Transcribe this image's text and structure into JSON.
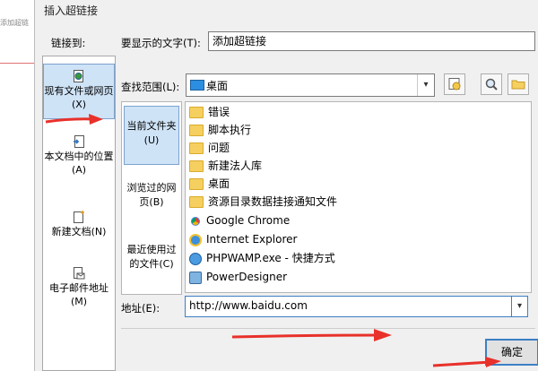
{
  "background": {
    "parent_text": "添加超链"
  },
  "dialog": {
    "title": "插入超链接",
    "link_to_label": "链接到:",
    "link_types": [
      {
        "label": "现有文件或网页(X)",
        "icon": "web-page-icon",
        "selected": true
      },
      {
        "label": "本文档中的位置(A)",
        "icon": "document-place-icon",
        "selected": false
      },
      {
        "label": "新建文档(N)",
        "icon": "new-document-icon",
        "selected": false
      },
      {
        "label": "电子邮件地址(M)",
        "icon": "email-icon",
        "selected": false
      }
    ],
    "display_text": {
      "label": "要显示的文字(T):",
      "value": "添加超链接"
    },
    "look_in": {
      "label": "查找范围(L):",
      "value": "桌面",
      "icon": "monitor-icon"
    },
    "nav_items": [
      {
        "label": "当前文件夹(U)",
        "selected": true
      },
      {
        "label": "浏览过的网页(B)",
        "selected": false
      },
      {
        "label": "最近使用过的文件(C)",
        "selected": false
      }
    ],
    "files": [
      {
        "name": "错误",
        "type": "folder"
      },
      {
        "name": "脚本执行",
        "type": "folder"
      },
      {
        "name": "问题",
        "type": "folder"
      },
      {
        "name": "新建法人库",
        "type": "folder"
      },
      {
        "name": "桌面",
        "type": "folder"
      },
      {
        "name": "资源目录数据挂接通知文件",
        "type": "folder"
      },
      {
        "name": "Google Chrome",
        "type": "app",
        "icon": "chrome-icon"
      },
      {
        "name": "Internet Explorer",
        "type": "app",
        "icon": "ie-icon"
      },
      {
        "name": "PHPWAMP.exe - 快捷方式",
        "type": "app",
        "icon": "phpwamp-icon"
      },
      {
        "name": "PowerDesigner",
        "type": "app",
        "icon": "powerdesigner-icon"
      }
    ],
    "address": {
      "label": "地址(E):",
      "value": "http://www.baidu.com"
    },
    "ok_label": "确定"
  },
  "colors": {
    "selection": "#cfe3f7",
    "accent": "#3c7fc4",
    "annotation_arrow": "#e8312a"
  }
}
